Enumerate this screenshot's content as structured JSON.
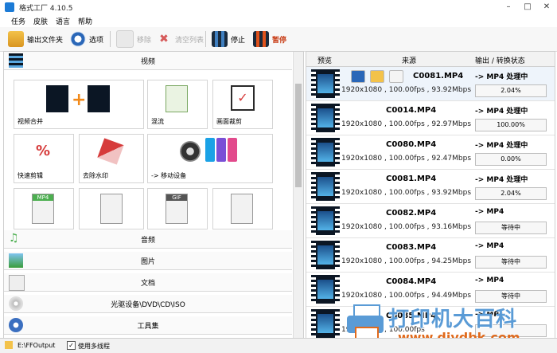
{
  "window": {
    "title": "格式工厂 4.10.5"
  },
  "menu": [
    "任务",
    "皮肤",
    "语言",
    "帮助"
  ],
  "toolbar": {
    "output_folder": "输出文件夹",
    "options": "选项",
    "remove": "移除",
    "clear_list": "清空列表",
    "stop": "停止",
    "pause": "暂停"
  },
  "left": {
    "video_category": "视频",
    "tiles": [
      "视频合并",
      "混流",
      "画面裁剪",
      "快速剪辑",
      "去除水印",
      "-> 移动设备"
    ],
    "categories": [
      "音频",
      "图片",
      "文档",
      "光驱设备\\DVD\\CD\\ISO",
      "工具集"
    ]
  },
  "right": {
    "headers": [
      "预览",
      "来源",
      "输出 / 转换状态"
    ],
    "rows": [
      {
        "name": "C0081.MP4",
        "info": "1920x1080 , 100.00fps , 93.92Mbps",
        "out": "-> MP4 处理中",
        "status": "2.04%"
      },
      {
        "name": "C0014.MP4",
        "info": "1920x1080 , 100.00fps , 92.97Mbps",
        "out": "-> MP4 处理中",
        "status": "100.00%"
      },
      {
        "name": "C0080.MP4",
        "info": "1920x1080 , 100.00fps , 92.47Mbps",
        "out": "-> MP4 处理中",
        "status": "0.00%"
      },
      {
        "name": "C0081.MP4",
        "info": "1920x1080 , 100.00fps , 93.92Mbps",
        "out": "-> MP4 处理中",
        "status": "2.04%"
      },
      {
        "name": "C0082.MP4",
        "info": "1920x1080 , 100.00fps , 93.16Mbps",
        "out": "-> MP4",
        "status": "等待中"
      },
      {
        "name": "C0083.MP4",
        "info": "1920x1080 , 100.00fps , 94.25Mbps",
        "out": "-> MP4",
        "status": "等待中"
      },
      {
        "name": "C0084.MP4",
        "info": "1920x1080 , 100.00fps , 94.49Mbps",
        "out": "-> MP4",
        "status": "等待中"
      },
      {
        "name": "C0085.MP4",
        "info": "1920x1080 , 100.00fps",
        "out": "-> MP4",
        "status": ""
      }
    ]
  },
  "status": {
    "path": "E:\\FFOutput",
    "multithread": "使用多线程"
  },
  "watermark": {
    "line1": "打印机大百科",
    "line2": "www.djydbk.com"
  },
  "colors": {
    "accent": "#1c7bd6",
    "film": "#0b1624"
  }
}
